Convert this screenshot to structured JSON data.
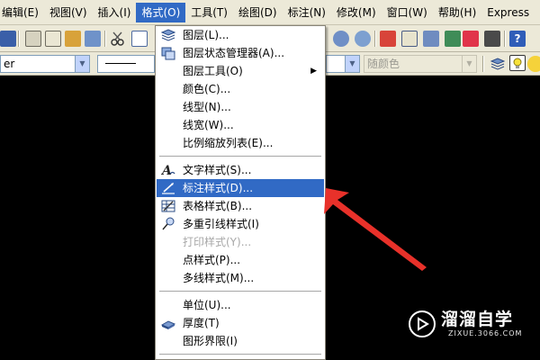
{
  "menubar": {
    "items": [
      "编辑(E)",
      "视图(V)",
      "插入(I)",
      "格式(O)",
      "工具(T)",
      "绘图(D)",
      "标注(N)",
      "修改(M)",
      "窗口(W)",
      "帮助(H)",
      "Express"
    ]
  },
  "toolbar": {
    "layer_combo": "er",
    "color_combo": "随颜色"
  },
  "format_menu": {
    "items": [
      {
        "label": "图层(L)...",
        "icon": "layers-icon"
      },
      {
        "label": "图层状态管理器(A)...",
        "icon": "layer-state-icon"
      },
      {
        "label": "图层工具(O)",
        "has_submenu": true
      },
      {
        "label": "颜色(C)..."
      },
      {
        "label": "线型(N)..."
      },
      {
        "label": "线宽(W)..."
      },
      {
        "label": "比例缩放列表(E)..."
      },
      {
        "label": "文字样式(S)...",
        "icon": "text-style-icon"
      },
      {
        "label": "标注样式(D)...",
        "icon": "dimension-style-icon",
        "highlighted": true
      },
      {
        "label": "表格样式(B)...",
        "icon": "table-style-icon"
      },
      {
        "label": "多重引线样式(I)",
        "icon": "multileader-style-icon"
      },
      {
        "label": "打印样式(Y)...",
        "disabled": true
      },
      {
        "label": "点样式(P)..."
      },
      {
        "label": "多线样式(M)..."
      },
      {
        "label": "单位(U)..."
      },
      {
        "label": "厚度(T)",
        "icon": "thickness-icon"
      },
      {
        "label": "图形界限(I)"
      }
    ],
    "submenu_arrow": "▶"
  },
  "watermark": {
    "title": "溜溜自学",
    "subtitle": "ZIXUE.3066.COM"
  },
  "colors": {
    "menu_highlight": "#316ac5",
    "canvas": "#000000",
    "arrow": "#e8312a",
    "chrome": "#ece9d8"
  }
}
